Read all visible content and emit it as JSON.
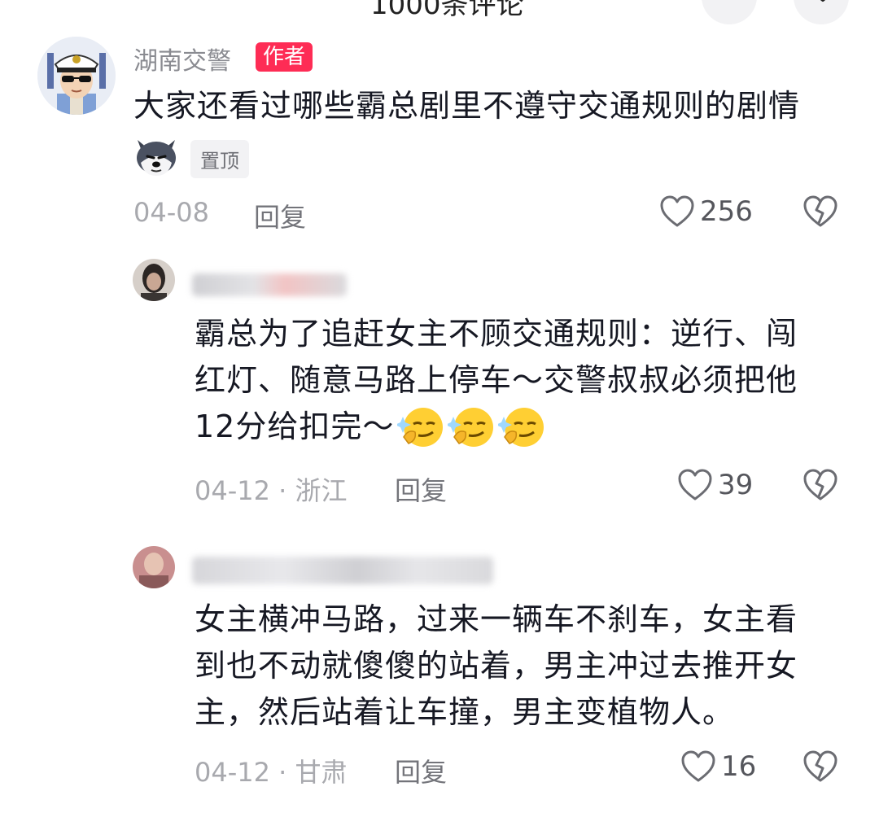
{
  "header": {
    "title_partial": "1000条评论"
  },
  "comments": [
    {
      "author": "湖南交警",
      "author_badge": "作者",
      "text": "大家还看过哪些霸总剧里不遵守交通规则的剧情",
      "pinned_label": "置顶",
      "date": "04-08",
      "reply_label": "回复",
      "likes": "256"
    },
    {
      "text_lines": [
        "霸总为了追赶女主不顾交通规则：逆行、闯",
        "红灯、随意马路上停车～交警叔叔必须把他",
        "12分给扣完～"
      ],
      "date": "04-12",
      "location": "浙江",
      "reply_label": "回复",
      "likes": "39"
    },
    {
      "text_lines": [
        "女主横冲马路，过来一辆车不刹车，女主看",
        "到也不动就傻傻的站着，男主冲过去推开女",
        "主，然后站着让车撞，男主变植物人。"
      ],
      "date": "04-12",
      "location": "甘肃",
      "reply_label": "回复",
      "likes": "16"
    }
  ],
  "separator": " · ",
  "icons": {
    "like": "heart-outline-icon",
    "dislike": "broken-heart-icon",
    "emoji": "smirk-emoji-icon",
    "sticker": "husky-sticker-icon"
  },
  "colors": {
    "badge": "#fe2c55",
    "text": "#161823",
    "meta": "#a8a9ae"
  }
}
